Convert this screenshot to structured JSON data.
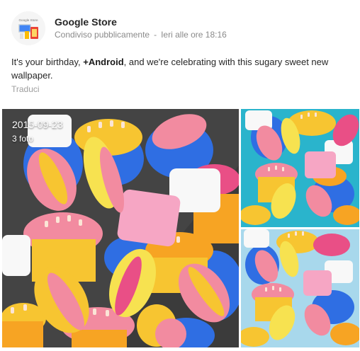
{
  "author": {
    "name": "Google Store",
    "avatar_label": "Google Store"
  },
  "meta": {
    "visibility": "Condiviso pubblicamente",
    "separator": "-",
    "timestamp": "Ieri alle ore 18:16"
  },
  "post": {
    "text_before": "It's your birthday, ",
    "mention": "+Android",
    "text_after": ", and we're celebrating with this sugary sweet new wallpaper.",
    "translate_label": "Traduci"
  },
  "gallery": {
    "date": "2015-09-23",
    "count": "3 foto",
    "tiles": [
      {
        "name": "main-photo",
        "background": "#3a3a3a"
      },
      {
        "name": "thumb-photo-teal",
        "background": "#2ab4cc"
      },
      {
        "name": "thumb-photo-lightblue",
        "background": "#a8d8ec"
      }
    ]
  },
  "colors": {
    "pink": "#f28ba0",
    "magenta": "#e94f86",
    "yellow": "#f7c531",
    "blue": "#2f6ee3",
    "cream": "#fbe5d6",
    "white": "#f8f8f8",
    "orange": "#f7a423"
  }
}
